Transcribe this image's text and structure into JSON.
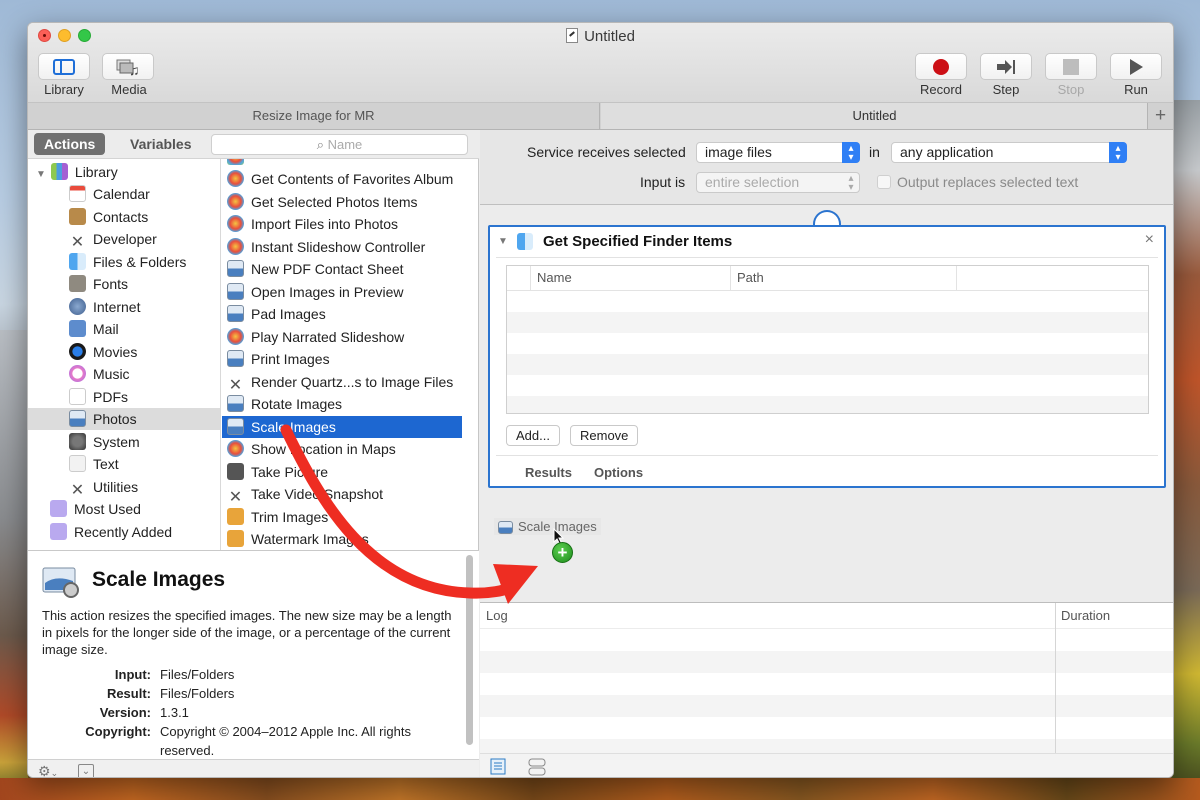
{
  "window": {
    "title": "Untitled",
    "colors": {
      "accent": "#1d67d1",
      "record": "#cc0f15",
      "arrow": "#ee2d22"
    }
  },
  "toolbar": {
    "library_label": "Library",
    "media_label": "Media",
    "record_label": "Record",
    "step_label": "Step",
    "stop_label": "Stop",
    "run_label": "Run"
  },
  "tabs": [
    {
      "label": "Resize Image for MR",
      "active": false
    },
    {
      "label": "Untitled",
      "active": true
    }
  ],
  "tab_add_label": "+",
  "library_panel": {
    "segments": {
      "actions": "Actions",
      "variables": "Variables"
    },
    "search_placeholder": "Name",
    "root_label": "Library",
    "categories": [
      {
        "label": "Calendar",
        "icon": "calendar-icon"
      },
      {
        "label": "Contacts",
        "icon": "contacts-icon"
      },
      {
        "label": "Developer",
        "icon": "developer-icon"
      },
      {
        "label": "Files & Folders",
        "icon": "finder-icon"
      },
      {
        "label": "Fonts",
        "icon": "fonts-icon"
      },
      {
        "label": "Internet",
        "icon": "internet-icon"
      },
      {
        "label": "Mail",
        "icon": "mail-icon"
      },
      {
        "label": "Movies",
        "icon": "movies-icon"
      },
      {
        "label": "Music",
        "icon": "music-icon"
      },
      {
        "label": "PDFs",
        "icon": "pdf-icon"
      },
      {
        "label": "Photos",
        "icon": "photos-icon",
        "selected": true
      },
      {
        "label": "System",
        "icon": "system-icon"
      },
      {
        "label": "Text",
        "icon": "text-icon"
      },
      {
        "label": "Utilities",
        "icon": "utilities-icon"
      }
    ],
    "smart_groups": [
      {
        "label": "Most Used",
        "icon": "folder-icon"
      },
      {
        "label": "Recently Added",
        "icon": "folder-icon"
      }
    ],
    "actions": [
      {
        "label": "Get Contents of Favorites Album",
        "icon": "photos-app-icon"
      },
      {
        "label": "Get Selected Photos Items",
        "icon": "photos-app-icon"
      },
      {
        "label": "Import Files into Photos",
        "icon": "photos-app-icon"
      },
      {
        "label": "Instant Slideshow Controller",
        "icon": "photos-app-icon"
      },
      {
        "label": "New PDF Contact Sheet",
        "icon": "preview-icon"
      },
      {
        "label": "Open Images in Preview",
        "icon": "preview-icon"
      },
      {
        "label": "Pad Images",
        "icon": "preview-icon"
      },
      {
        "label": "Play Narrated Slideshow",
        "icon": "photos-app-icon"
      },
      {
        "label": "Print Images",
        "icon": "preview-icon"
      },
      {
        "label": "Render Quartz...s to Image Files",
        "icon": "developer-icon"
      },
      {
        "label": "Rotate Images",
        "icon": "preview-icon"
      },
      {
        "label": "Scale Images",
        "icon": "preview-icon",
        "selected": true
      },
      {
        "label": "Show Location in Maps",
        "icon": "photos-app-icon"
      },
      {
        "label": "Take Picture",
        "icon": "camera-icon"
      },
      {
        "label": "Take Video Snapshot",
        "icon": "developer-icon"
      },
      {
        "label": "Trim Images",
        "icon": "image-edit-icon"
      },
      {
        "label": "Watermark Images",
        "icon": "image-edit-icon"
      }
    ]
  },
  "description": {
    "title": "Scale Images",
    "text": "This action resizes the specified images. The new size may be a length in pixels for the longer side of the image, or a percentage of the current image size.",
    "meta": [
      {
        "key": "Input:",
        "value": "Files/Folders"
      },
      {
        "key": "Result:",
        "value": "Files/Folders"
      },
      {
        "key": "Version:",
        "value": "1.3.1"
      },
      {
        "key": "Copyright:",
        "value": "Copyright © 2004–2012 Apple Inc.  All rights reserved."
      }
    ]
  },
  "service": {
    "receives_label": "Service receives selected",
    "receives_value": "image files",
    "in_label": "in",
    "app_value": "any application",
    "input_is_label": "Input is",
    "input_is_value": "entire selection",
    "output_replaces_label": "Output replaces selected text",
    "output_replaces_checked": false
  },
  "action_box": {
    "title": "Get Specified Finder Items",
    "close_label": "×",
    "columns": [
      "Name",
      "Path"
    ],
    "rows": [],
    "add_label": "Add...",
    "remove_label": "Remove",
    "tabs": [
      "Results",
      "Options"
    ]
  },
  "drag_ghost": {
    "label": "Scale Images",
    "badge": "+"
  },
  "log": {
    "columns": [
      "Log",
      "Duration"
    ]
  }
}
